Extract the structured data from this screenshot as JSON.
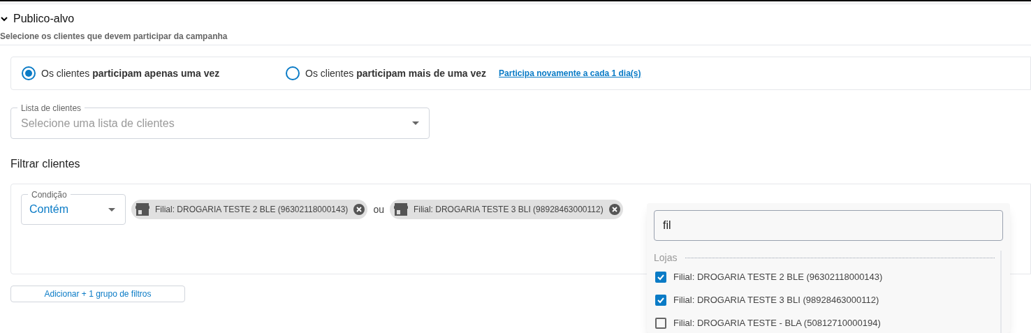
{
  "section": {
    "title": "Publico-alvo",
    "expanded": true,
    "subtitle": "Selecione os clientes que devem participar da campanha"
  },
  "participation": {
    "options": [
      {
        "label": "Os clientes **participam apenas uma vez**",
        "selected": true
      },
      {
        "label": "Os clientes **participam mais de uma vez**",
        "selected": false
      }
    ],
    "link": "Participa novamente a cada 1 dia(s)"
  },
  "client_list": {
    "label": "Lista de clientes",
    "placeholder": "Selecione uma lista de clientes"
  },
  "filters": {
    "title": "Filtrar clientes",
    "condition": {
      "label": "Condição",
      "value": "Contém"
    },
    "chips": [
      {
        "label": "Filial: DROGARIA TESTE 2 BLE (96302118000143)"
      },
      {
        "label": "Filial: DROGARIA TESTE 3 BLI (98928463000112)"
      }
    ],
    "separator": "ou",
    "add_group": "Adicionar + 1 grupo de filtros"
  },
  "dropdown": {
    "search": "fil",
    "group": "Lojas",
    "options": [
      {
        "label": "Filial: DROGARIA TESTE 2 BLE (96302118000143)",
        "checked": true
      },
      {
        "label": "Filial: DROGARIA TESTE 3 BLI (98928463000112)",
        "checked": true
      },
      {
        "label": "Filial: DROGARIA TESTE - BLA (50812710000194)",
        "checked": false
      }
    ]
  }
}
